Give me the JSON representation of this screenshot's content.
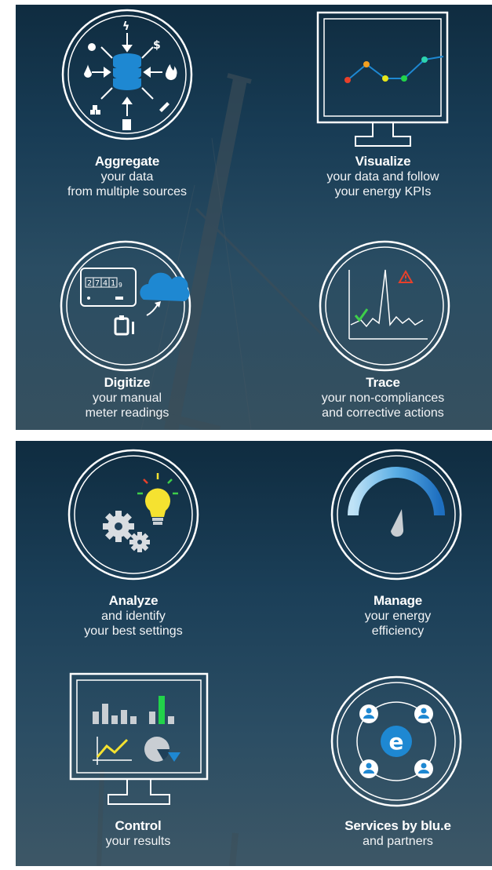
{
  "features": [
    {
      "id": "aggregate",
      "title": "Aggregate",
      "lines": [
        "your data",
        "from multiple sources"
      ]
    },
    {
      "id": "visualize",
      "title": "Visualize",
      "lines": [
        "your data and follow",
        "your energy KPIs"
      ]
    },
    {
      "id": "digitize",
      "title": "Digitize",
      "lines": [
        "your manual",
        "meter readings"
      ],
      "meter_digits": [
        "2",
        "7",
        "4",
        "1",
        "9"
      ]
    },
    {
      "id": "trace",
      "title": "Trace",
      "lines": [
        "your non-compliances",
        "and corrective actions"
      ]
    },
    {
      "id": "analyze",
      "title": "Analyze",
      "lines": [
        "and identify",
        "your best settings"
      ]
    },
    {
      "id": "manage",
      "title": "Manage",
      "lines": [
        "your energy",
        "efficiency"
      ]
    },
    {
      "id": "control",
      "title": "Control",
      "lines": [
        "your results"
      ]
    },
    {
      "id": "services",
      "title": "Services by blu.e",
      "lines": [
        "and partners"
      ],
      "logo_letter": "e"
    }
  ],
  "colors": {
    "accent_blue": "#1e88d2",
    "light_blue": "#7cc4ef",
    "alert_red": "#e8402a",
    "check_green": "#3ecf4a",
    "bulb_yellow": "#f5e230",
    "chart_green": "#22d34a",
    "chart_yellow": "#e6e61a",
    "chart_teal": "#2cd3b0",
    "chart_orange": "#f3a020"
  },
  "icons": [
    "database-icon",
    "line-chart-monitor-icon",
    "meter-cloud-icon",
    "alert-peak-chart-icon",
    "gears-bulb-icon",
    "gauge-icon",
    "dashboard-monitor-icon",
    "network-people-icon"
  ]
}
